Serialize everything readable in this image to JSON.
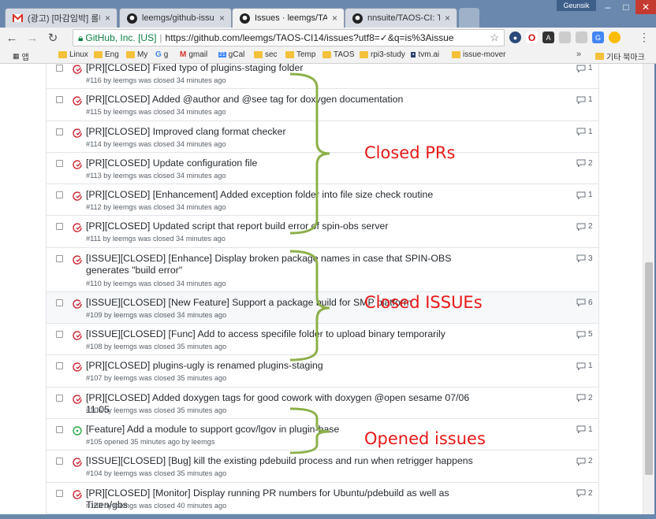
{
  "browser": {
    "tabs": [
      {
        "label": "(광고) [마감임박] 롤더블",
        "icon": "gmail-icon",
        "active": false
      },
      {
        "label": "leemgs/github-issues-im",
        "icon": "github-icon",
        "active": false
      },
      {
        "label": "Issues · leemgs/TAOS-CI",
        "icon": "github-icon",
        "active": true
      },
      {
        "label": "nnsuite/TAOS-CI: TAOS",
        "icon": "github-icon",
        "active": false
      }
    ],
    "user": "Geunsik",
    "address": {
      "secure_label": "GitHub, Inc. [US]",
      "url": "https://github.com/leemgs/TAOS-CI14/issues?utf8=✓&q=is%3Aissue"
    },
    "bookmarks": [
      {
        "label": "앱",
        "icon": "apps-icon"
      },
      {
        "label": "Linux",
        "icon": "folder-icon"
      },
      {
        "label": "Eng",
        "icon": "folder-icon"
      },
      {
        "label": "My",
        "icon": "folder-icon"
      },
      {
        "label": "g",
        "icon": "google-icon"
      },
      {
        "label": "gmail",
        "icon": "gmail-icon"
      },
      {
        "label": "gCal",
        "icon": "calendar-icon"
      },
      {
        "label": "sec",
        "icon": "folder-icon"
      },
      {
        "label": "Temp",
        "icon": "folder-icon"
      },
      {
        "label": "TAOS",
        "icon": "folder-icon"
      },
      {
        "label": "rpi3-study",
        "icon": "folder-icon"
      },
      {
        "label": "tvm.ai",
        "icon": "tvm-icon"
      },
      {
        "label": "issue-mover",
        "icon": "folder-icon"
      }
    ],
    "other_bookmarks": "기타 북마크"
  },
  "issues": [
    {
      "title": "[PR][CLOSED] Fixed typo of plugins-staging folder",
      "meta": "#116 by leemgs was closed 34 minutes ago",
      "comments": "1",
      "state": "closed"
    },
    {
      "title": "[PR][CLOSED] Added @author and @see tag for doxygen documentation",
      "meta": "#115 by leemgs was closed 34 minutes ago",
      "comments": "1",
      "state": "closed"
    },
    {
      "title": "[PR][CLOSED] Improved clang format checker",
      "meta": "#114 by leemgs was closed 34 minutes ago",
      "comments": "1",
      "state": "closed"
    },
    {
      "title": "[PR][CLOSED] Update configuration file",
      "meta": "#113 by leemgs was closed 34 minutes ago",
      "comments": "2",
      "state": "closed"
    },
    {
      "title": "[PR][CLOSED] [Enhancement] Added exception folder into file size check routine",
      "meta": "#112 by leemgs was closed 34 minutes ago",
      "comments": "1",
      "state": "closed"
    },
    {
      "title": "[PR][CLOSED] Updated script that report build error of spin-obs server",
      "meta": "#111 by leemgs was closed 34 minutes ago",
      "comments": "2",
      "state": "closed"
    },
    {
      "title": "[ISSUE][CLOSED] [Enhance] Display broken package names in case that SPIN-OBS generates \"build error\"",
      "meta": "#110 by leemgs was closed 34 minutes ago",
      "comments": "3",
      "state": "closed"
    },
    {
      "title": "[ISSUE][CLOSED] [New Feature] Support a package build for SMP platform",
      "meta": "#109 by leemgs was closed 34 minutes ago",
      "comments": "6",
      "state": "closed"
    },
    {
      "title": "[ISSUE][CLOSED] [Func] Add to access specifile folder to upload binary temporarily",
      "meta": "#108 by leemgs was closed 35 minutes ago",
      "comments": "5",
      "state": "closed"
    },
    {
      "title": "[PR][CLOSED] plugins-ugly is renamed plugins-staging",
      "meta": "#107 by leemgs was closed 35 minutes ago",
      "comments": "1",
      "state": "closed"
    },
    {
      "title": "[PR][CLOSED] Added doxygen tags for good cowork with doxygen @open sesame 07/06 11:05",
      "meta": "#106 by leemgs was closed 35 minutes ago",
      "comments": "2",
      "state": "closed"
    },
    {
      "title": "[Feature] Add a module to support gcov/lgov in plugin-base",
      "meta": "#105 opened 35 minutes ago by leemgs",
      "comments": "1",
      "state": "open"
    },
    {
      "title": "[ISSUE][CLOSED] [Bug] kill the existing pdebuild process and run when retrigger happens",
      "meta": "#104 by leemgs was closed 35 minutes ago",
      "comments": "2",
      "state": "closed"
    },
    {
      "title": "[PR][CLOSED] [Monitor] Display running PR numbers for Ubuntu/pdebuild as well as Tizen/gbs",
      "meta": "#103 by leemgs was closed 40 minutes ago",
      "comments": "2",
      "state": "closed"
    }
  ],
  "annotations": {
    "closed_prs": "Closed PRs",
    "closed_issues": "Closed ISSUEs",
    "opened_issues": "Opened issues",
    "color": "#e81818",
    "brace_color": "#8db04a"
  },
  "colors": {
    "closed": "#cb2431",
    "open": "#28a745"
  }
}
